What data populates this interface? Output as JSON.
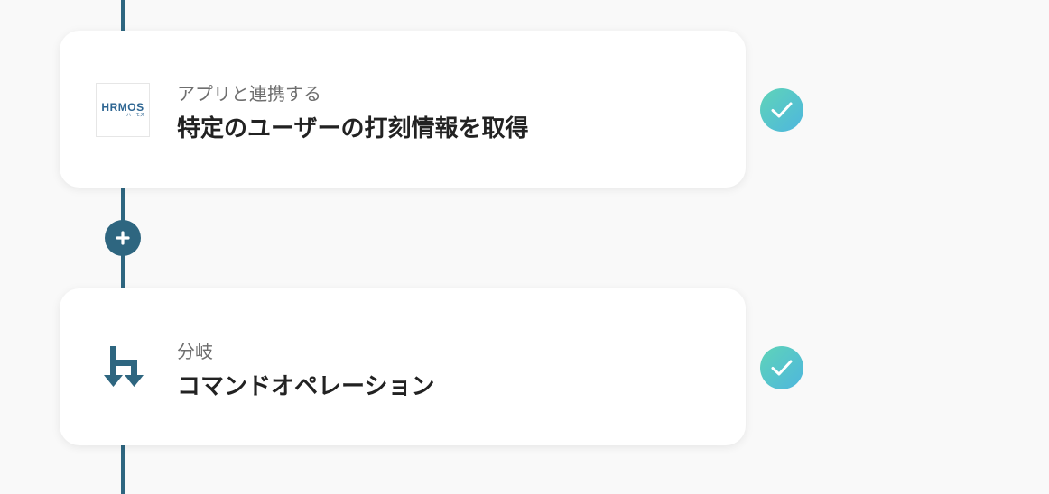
{
  "flow": {
    "steps": [
      {
        "type_label": "アプリと連携する",
        "title": "特定のユーザーの打刻情報を取得",
        "logo": {
          "icon": "hrmos-logo",
          "main_text": "HRMOS",
          "sub_text": "ハーモス",
          "color": "#2d6592"
        },
        "status": "completed"
      },
      {
        "type_label": "分岐",
        "title": "コマンドオペレーション",
        "logo": {
          "icon": "branch-icon",
          "color": "#2e6680"
        },
        "status": "completed"
      }
    ],
    "colors": {
      "connector": "#2e6680",
      "check_gradient_start": "#5fd4b8",
      "check_gradient_end": "#4eb6de",
      "background": "#f9f9f9"
    }
  }
}
